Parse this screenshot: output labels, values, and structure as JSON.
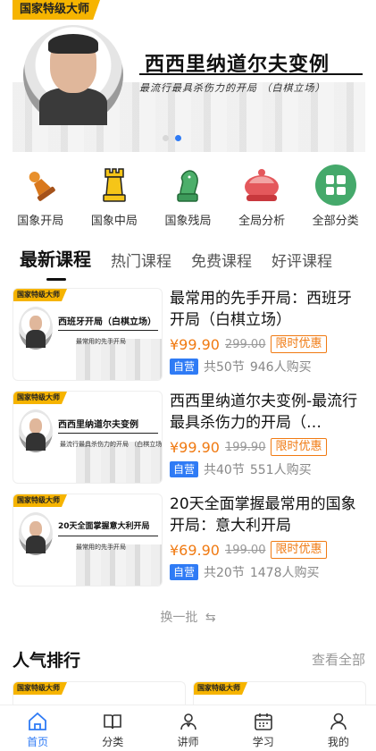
{
  "banner": {
    "badge": "国家特级大师",
    "title": "西西里纳道尔夫变例",
    "subtitle": "最流行最具杀伤力的开局  （白棋立场）"
  },
  "categories": [
    {
      "label": "国象开局",
      "icon": "pawn-icon"
    },
    {
      "label": "国象中局",
      "icon": "rook-icon"
    },
    {
      "label": "国象残局",
      "icon": "knight-icon"
    },
    {
      "label": "全局分析",
      "icon": "crown-icon"
    },
    {
      "label": "全部分类",
      "icon": "grid-icon"
    }
  ],
  "tabs": [
    "最新课程",
    "热门课程",
    "免费课程",
    "好评课程"
  ],
  "courses": [
    {
      "thumb_badge": "国家特级大师",
      "thumb_title": "西班牙开局（白棋立场）",
      "thumb_sub": "最常用的先手开局",
      "title": "最常用的先手开局：西班牙开局（白棋立场）",
      "price": "¥99.90",
      "orig_price": "299.00",
      "promo": "限时优惠",
      "self_label": "自营",
      "lessons": "共50节",
      "buyers": "946人购买"
    },
    {
      "thumb_badge": "国家特级大师",
      "thumb_title": "西西里纳道尔夫变例",
      "thumb_sub": "最流行最具杀伤力的开局 （白棋立场）",
      "title": "西西里纳道尔夫变例-最流行最具杀伤力的开局（…",
      "price": "¥99.90",
      "orig_price": "199.90",
      "promo": "限时优惠",
      "self_label": "自营",
      "lessons": "共40节",
      "buyers": "551人购买"
    },
    {
      "thumb_badge": "国家特级大师",
      "thumb_title": "20天全面掌握意大利开局",
      "thumb_sub": "最常用的先手开局",
      "title": "20天全面掌握最常用的国象开局：意大利开局",
      "price": "¥69.90",
      "orig_price": "199.00",
      "promo": "限时优惠",
      "self_label": "自营",
      "lessons": "共20节",
      "buyers": "1478人购买"
    }
  ],
  "refresh_label": "换一批",
  "popular": {
    "title": "人气排行",
    "view_all": "查看全部",
    "card_badges": [
      "国家特级大师",
      "国家特级大师"
    ]
  },
  "nav": [
    {
      "label": "首页",
      "icon": "home-icon"
    },
    {
      "label": "分类",
      "icon": "book-icon"
    },
    {
      "label": "讲师",
      "icon": "teacher-icon"
    },
    {
      "label": "学习",
      "icon": "calendar-icon"
    },
    {
      "label": "我的",
      "icon": "user-icon"
    }
  ],
  "colors": {
    "accent": "#2f7bf5",
    "price": "#f07a12",
    "badge": "#f6b400"
  }
}
